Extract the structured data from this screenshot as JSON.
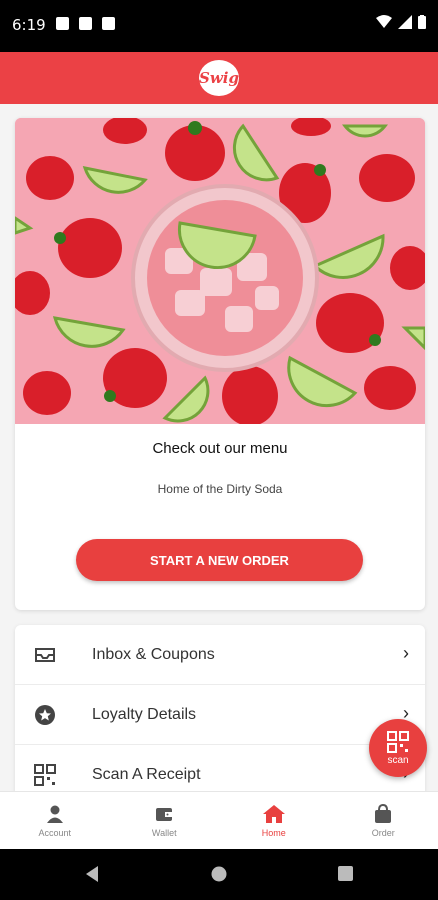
{
  "status_bar": {
    "time": "6:19"
  },
  "header": {
    "logo_text": "Swig"
  },
  "card": {
    "title": "Check out our menu",
    "subtitle": "Home of the Dirty Soda",
    "button_label": "START A NEW ORDER"
  },
  "menu": {
    "items": [
      {
        "label": "Inbox & Coupons",
        "icon": "inbox-icon"
      },
      {
        "label": "Loyalty Details",
        "icon": "star-badge-icon"
      },
      {
        "label": "Scan A Receipt",
        "icon": "qr-code-icon"
      }
    ]
  },
  "scan_fab": {
    "label": "scan"
  },
  "bottom_nav": {
    "items": [
      {
        "label": "Account",
        "icon": "person-icon"
      },
      {
        "label": "Wallet",
        "icon": "wallet-icon"
      },
      {
        "label": "Home",
        "icon": "home-icon"
      },
      {
        "label": "Order",
        "icon": "bag-icon"
      }
    ],
    "active": "Home"
  },
  "colors": {
    "accent": "#eb4145",
    "hero_background": "#f5a6b3"
  }
}
